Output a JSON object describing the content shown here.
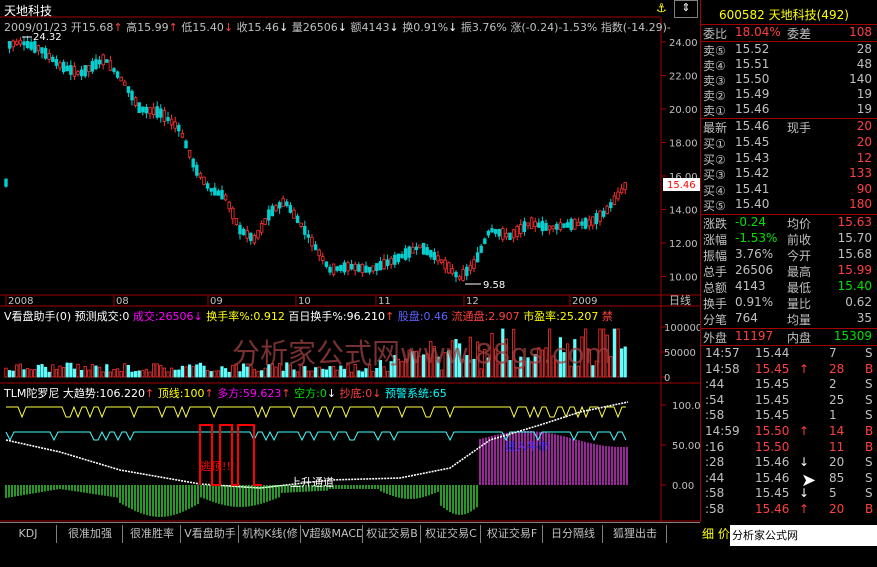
{
  "stock": {
    "name": "天地科技",
    "code": "600582",
    "code_full": "600582 天地科技(492)",
    "date": "2009/01/23",
    "open_label": "开15.68",
    "high_label": "高15.99",
    "low_label": "低15.40",
    "close_label": "收15.46",
    "vol_label": "量26506",
    "amt_label": "额4143",
    "turnover_label": "换0.91%",
    "amp_label": "振3.76%",
    "change_label": "涨(-0.24)-1.53%",
    "index_label": "指数(-14.29)-"
  },
  "price_chart": {
    "y_ticks": [
      "24.00",
      "22.00",
      "20.00",
      "18.00",
      "16.00",
      "14.00",
      "12.00",
      "10.00"
    ],
    "max_label": "24.32",
    "min_label": "9.58",
    "current_price_tag": "15.46",
    "x_labels": [
      "2008",
      "08",
      "09",
      "10",
      "11",
      "12",
      "2009"
    ],
    "period_label": "日线"
  },
  "volume_panel": {
    "title": "V看盘助手(0)",
    "forecast": "预测成交:0",
    "vol": "成交:26506",
    "turnover": "换手率%:0.912",
    "hundred_day": "百日换手%:96.210",
    "cap": "股盘:0.46",
    "float": "流通盘:2.907",
    "pe": "市盈率:25.207",
    "tail": "禁",
    "y_ticks": [
      "100000",
      "50000",
      "0"
    ],
    "watermark": "分析家公式网www.88gs.com"
  },
  "indicator_panel": {
    "name": "TLM陀罗尼",
    "trend": "大趋势:106.220",
    "top": "顶线:100",
    "long": "多方:59.623",
    "short": "空方:0",
    "bottom": "抄底:0",
    "warn": "预警系统:65",
    "y_ticks": [
      "100.00",
      "50.00",
      "0.00"
    ],
    "label_escape": "逃顶!!",
    "label_channel": "上升通道",
    "label_bull": "进入牛市"
  },
  "quote": {
    "header": "600582 天地科技(492)",
    "weibi_label": "委比",
    "weibi_value": "18.04%",
    "weicha_label": "委差",
    "weicha_value": "108",
    "asks": [
      {
        "label": "卖⑤",
        "price": "15.52",
        "vol": "28"
      },
      {
        "label": "卖④",
        "price": "15.51",
        "vol": "48"
      },
      {
        "label": "卖③",
        "price": "15.50",
        "vol": "140"
      },
      {
        "label": "卖②",
        "price": "15.49",
        "vol": "19"
      },
      {
        "label": "卖①",
        "price": "15.46",
        "vol": "19"
      }
    ],
    "last_label": "最新",
    "last_price": "15.46",
    "now_label": "现手",
    "now_vol": "20",
    "bids": [
      {
        "label": "买①",
        "price": "15.45",
        "vol": "20"
      },
      {
        "label": "买②",
        "price": "15.43",
        "vol": "12"
      },
      {
        "label": "买③",
        "price": "15.42",
        "vol": "133"
      },
      {
        "label": "买④",
        "price": "15.41",
        "vol": "90"
      },
      {
        "label": "买⑤",
        "price": "15.40",
        "vol": "180"
      }
    ],
    "stats": [
      {
        "l1": "涨跌",
        "v1": "-0.24",
        "l2": "均价",
        "v2": "15.63",
        "c1": "green",
        "c2": "red"
      },
      {
        "l1": "涨幅",
        "v1": "-1.53%",
        "l2": "前收",
        "v2": "15.70",
        "c1": "green",
        "c2": "gray"
      },
      {
        "l1": "振幅",
        "v1": "3.76%",
        "l2": "今开",
        "v2": "15.68",
        "c1": "gray",
        "c2": "gray"
      },
      {
        "l1": "总手",
        "v1": "26506",
        "l2": "最高",
        "v2": "15.99",
        "c1": "gray",
        "c2": "red"
      },
      {
        "l1": "总额",
        "v1": "4143",
        "l2": "最低",
        "v2": "15.40",
        "c1": "gray",
        "c2": "green"
      },
      {
        "l1": "换手",
        "v1": "0.91%",
        "l2": "量比",
        "v2": "0.62",
        "c1": "gray",
        "c2": "gray"
      },
      {
        "l1": "分笔",
        "v1": "764",
        "l2": "均量",
        "v2": "35",
        "c1": "gray",
        "c2": "gray"
      }
    ],
    "outer_label": "外盘",
    "outer_value": "11197",
    "inner_label": "内盘",
    "inner_value": "15309",
    "ticks": [
      {
        "time": "14:57",
        "price": "15.44",
        "arrow": "",
        "vol": "7",
        "side": "S",
        "pc": "gray",
        "vc": "gray"
      },
      {
        "time": "14:58",
        "price": "15.45",
        "arrow": "↑",
        "vol": "28",
        "side": "B",
        "pc": "red",
        "vc": "red"
      },
      {
        "time": ":44",
        "price": "15.45",
        "arrow": "",
        "vol": "2",
        "side": "S",
        "pc": "gray",
        "vc": "gray"
      },
      {
        "time": ":54",
        "price": "15.45",
        "arrow": "",
        "vol": "25",
        "side": "S",
        "pc": "gray",
        "vc": "gray"
      },
      {
        "time": ":58",
        "price": "15.45",
        "arrow": "",
        "vol": "1",
        "side": "S",
        "pc": "gray",
        "vc": "gray"
      },
      {
        "time": "14:59",
        "price": "15.50",
        "arrow": "↑",
        "vol": "14",
        "side": "B",
        "pc": "red",
        "vc": "red"
      },
      {
        "time": ":16",
        "price": "15.50",
        "arrow": "",
        "vol": "11",
        "side": "B",
        "pc": "red",
        "vc": "red"
      },
      {
        "time": ":28",
        "price": "15.46",
        "arrow": "↓",
        "vol": "20",
        "side": "S",
        "pc": "gray",
        "vc": "gray"
      },
      {
        "time": ":44",
        "price": "15.46",
        "arrow": "",
        "vol": "85",
        "side": "S",
        "pc": "gray",
        "vc": "gray"
      },
      {
        "time": ":58",
        "price": "15.45",
        "arrow": "↓",
        "vol": "5",
        "side": "S",
        "pc": "gray",
        "vc": "gray"
      },
      {
        "time": ":58",
        "price": "15.46",
        "arrow": "↑",
        "vol": "20",
        "side": "B",
        "pc": "red",
        "vc": "red"
      }
    ]
  },
  "tabs": [
    "KDJ",
    "很准加强",
    "很准胜率",
    "V看盘助手",
    "机构K线(修",
    "V超级MACD",
    "权证交易B",
    "权证交易C",
    "权证交易F",
    "日分隔线",
    "狐狸出击"
  ],
  "bottom_site": "分析家公式网www.88gs.com",
  "bottom_partial": "细 价"
}
